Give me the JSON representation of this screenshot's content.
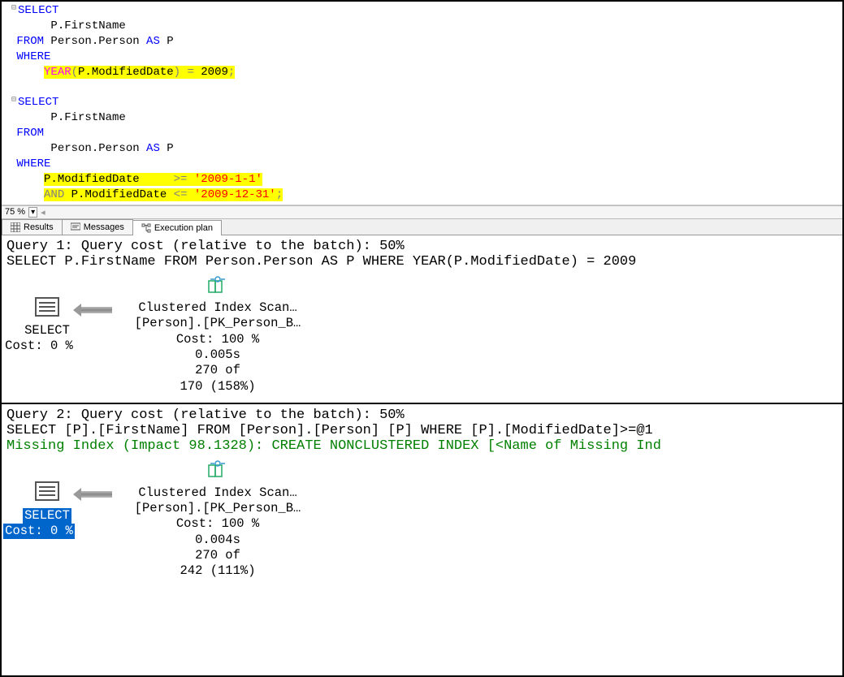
{
  "editor": {
    "q1": {
      "select": "SELECT",
      "col": "P.FirstName",
      "from": "FROM",
      "from_tbl": "Person.Person",
      "as": "AS",
      "alias": "P",
      "where": "WHERE",
      "year_fn": "YEAR",
      "year_arg_open": "(",
      "year_col": "P.ModifiedDate",
      "year_arg_close": ")",
      "eq": " = ",
      "year_val": "2009",
      "semi": ";"
    },
    "q2": {
      "select": "SELECT",
      "col": "P.FirstName",
      "from": "FROM",
      "from_tbl": "Person.Person",
      "as": "AS",
      "alias": "P",
      "where": "WHERE",
      "c1_col": "P.ModifiedDate",
      "c1_pad": "     ",
      "c1_op": ">=",
      "c1_val": "'2009-1-1'",
      "and": "AND",
      "c2_col": "P.ModifiedDate",
      "c2_op": "<=",
      "c2_val": "'2009-12-31'",
      "semi": ";"
    }
  },
  "zoom": {
    "value": "75 %"
  },
  "tabs": {
    "results": "Results",
    "messages": "Messages",
    "plan": "Execution plan"
  },
  "plan": {
    "q1": {
      "header": "Query 1: Query cost (relative to the batch): 50%",
      "sql": "SELECT P.FirstName FROM Person.Person AS P WHERE YEAR(P.ModifiedDate) = 2009",
      "select_label": "SELECT",
      "select_cost": "Cost: 0 %",
      "op_title": "Clustered Index Scan…",
      "op_obj": "[Person].[PK_Person_B…",
      "op_cost": "Cost: 100 %",
      "op_time": "0.005s",
      "op_rows1": "270 of",
      "op_rows2": "170 (158%)"
    },
    "q2": {
      "header": "Query 2: Query cost (relative to the batch): 50%",
      "sql": "SELECT [P].[FirstName] FROM [Person].[Person] [P] WHERE [P].[ModifiedDate]>=@1",
      "missing": "Missing Index (Impact 98.1328): CREATE NONCLUSTERED INDEX [<Name of Missing Ind",
      "select_label": "SELECT",
      "select_cost": "Cost: 0 %",
      "op_title": "Clustered Index Scan…",
      "op_obj": "[Person].[PK_Person_B…",
      "op_cost": "Cost: 100 %",
      "op_time": "0.004s",
      "op_rows1": "270 of",
      "op_rows2": "242 (111%)"
    }
  }
}
